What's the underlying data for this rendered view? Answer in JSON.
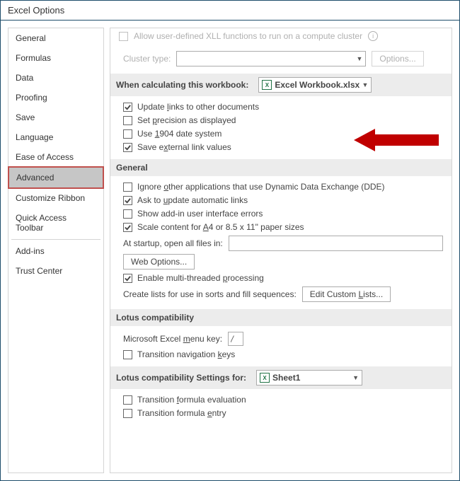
{
  "title": "Excel Options",
  "sidebar": {
    "items": [
      {
        "label": "General"
      },
      {
        "label": "Formulas"
      },
      {
        "label": "Data"
      },
      {
        "label": "Proofing"
      },
      {
        "label": "Save"
      },
      {
        "label": "Language"
      },
      {
        "label": "Ease of Access"
      },
      {
        "label": "Advanced"
      },
      {
        "label": "Customize Ribbon"
      },
      {
        "label": "Quick Access Toolbar"
      },
      {
        "label": "Add-ins"
      },
      {
        "label": "Trust Center"
      }
    ]
  },
  "cutoff": {
    "text": "Allow user-defined XLL functions to run on a compute cluster",
    "cluster_label": "Cluster type:",
    "options_btn": "Options..."
  },
  "calc": {
    "header": "When calculating this workbook:",
    "workbook": "Excel Workbook.xlsx",
    "update_links": "Update links to other documents",
    "precision": "Set precision as displayed",
    "date1904": "Use 1904 date system",
    "save_external": "Save external link values"
  },
  "general": {
    "header": "General",
    "ignore_dde": "Ignore other applications that use Dynamic Data Exchange (DDE)",
    "ask_update": "Ask to update automatic links",
    "show_errors": "Show add-in user interface errors",
    "scale_a4": "Scale content for A4 or 8.5 x 11\" paper sizes",
    "startup_label": "At startup, open all files in:",
    "web_options": "Web Options...",
    "multithread": "Enable multi-threaded processing",
    "create_lists_label": "Create lists for use in sorts and fill sequences:",
    "edit_lists": "Edit Custom Lists..."
  },
  "lotus": {
    "header": "Lotus compatibility",
    "menu_key_label": "Microsoft Excel menu key:",
    "menu_key_value": "/",
    "nav_keys": "Transition navigation keys"
  },
  "lotus_settings": {
    "header": "Lotus compatibility Settings for:",
    "sheet": "Sheet1",
    "formula_eval": "Transition formula evaluation",
    "formula_entry": "Transition formula entry"
  }
}
